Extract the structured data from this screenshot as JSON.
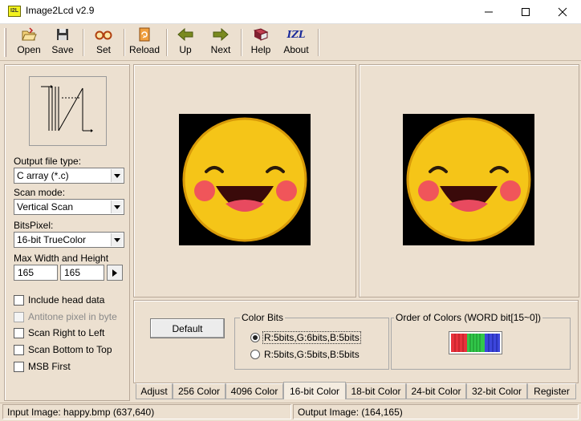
{
  "window": {
    "title": "Image2Lcd v2.9",
    "app_icon_text": "I2L"
  },
  "toolbar": {
    "buttons": [
      {
        "label": "Open",
        "icon": "folder-open-icon"
      },
      {
        "label": "Save",
        "icon": "floppy-disk-icon"
      },
      {
        "label": "Set",
        "icon": "glasses-icon"
      },
      {
        "label": "Reload",
        "icon": "reload-document-icon"
      },
      {
        "label": "Up",
        "icon": "arrow-left-icon"
      },
      {
        "label": "Next",
        "icon": "arrow-right-icon"
      },
      {
        "label": "Help",
        "icon": "help-book-icon"
      },
      {
        "label": "About",
        "icon": "izl-logo-icon",
        "icon_text": "IZL"
      }
    ]
  },
  "left_panel": {
    "output_file_type": {
      "label": "Output file type:",
      "value": "C array (*.c)"
    },
    "scan_mode": {
      "label": "Scan mode:",
      "value": "Vertical Scan"
    },
    "bits_pixel": {
      "label": "BitsPixel:",
      "value": "16-bit TrueColor"
    },
    "max_size": {
      "label": "Max Width and Height",
      "width": "165",
      "height": "165"
    },
    "checkboxes": [
      {
        "label": "Include head data",
        "checked": false,
        "enabled": true
      },
      {
        "label": "Antitone pixel in byte",
        "checked": false,
        "enabled": false
      },
      {
        "label": "Scan Right to Left",
        "checked": false,
        "enabled": true
      },
      {
        "label": "Scan Bottom to Top",
        "checked": false,
        "enabled": true
      },
      {
        "label": "MSB First",
        "checked": false,
        "enabled": true
      }
    ]
  },
  "settings": {
    "default_button": "Default",
    "color_bits": {
      "title": "Color Bits",
      "options": [
        {
          "label": "R:5bits,G:6bits,B:5bits",
          "selected": true
        },
        {
          "label": "R:5bits,G:5bits,B:5bits",
          "selected": false
        }
      ]
    },
    "order_of_colors": {
      "title": "Order of Colors (WORD bit[15~0])"
    }
  },
  "tabs": {
    "items": [
      "Adjust",
      "256 Color",
      "4096 Color",
      "16-bit Color",
      "18-bit Color",
      "24-bit Color",
      "32-bit Color",
      "Register"
    ],
    "active": "16-bit Color"
  },
  "status": {
    "input": "Input Image: happy.bmp (637,640)",
    "output": "Output Image: (164,165)"
  },
  "colors": {
    "background": "#ece0d0",
    "smiley_yellow": "#f5c518",
    "smiley_cheek": "#f0555a",
    "smiley_tongue": "#e84a5f",
    "bit_red": "#e8323c",
    "bit_green": "#32c84a",
    "bit_blue": "#3c46dc"
  }
}
